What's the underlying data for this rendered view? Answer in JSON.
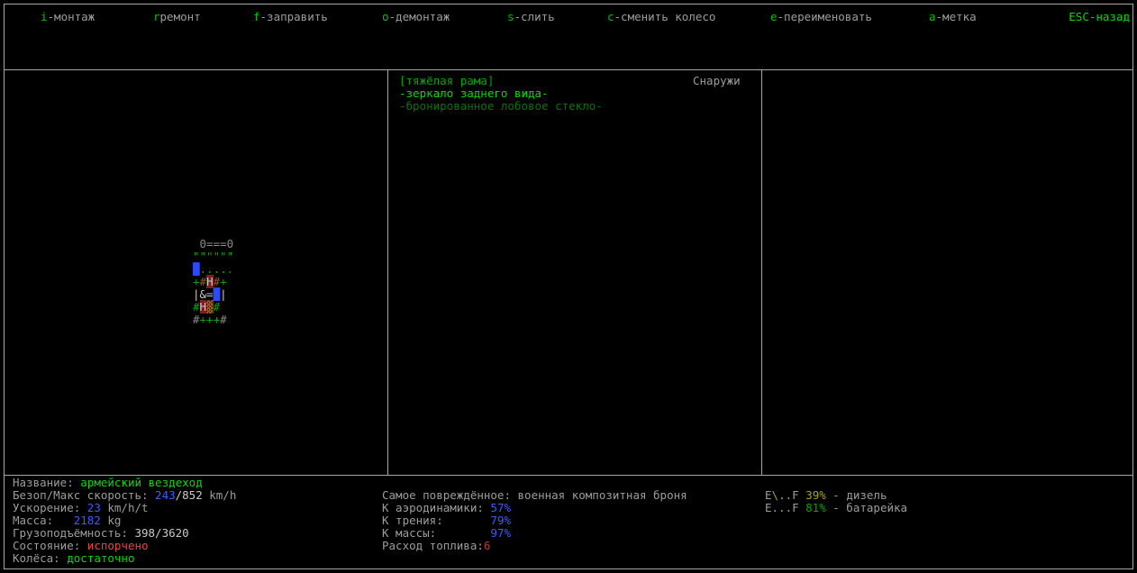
{
  "colors": {
    "label": "#9c9c9c",
    "white": "#c9c9c9",
    "gray": "#8a8a8a",
    "hotkey": "#00c000",
    "green_bright": "#00dc00",
    "green": "#00a800",
    "green_dark": "#0b700b",
    "blue": "#3c5cff",
    "blue_bright": "#2a4aff",
    "red": "#e04848",
    "red_dark": "#b23b2e",
    "yellow": "#a8a800",
    "brown": "#9c5a28",
    "seat_bg": "#7e1f1f"
  },
  "menu": {
    "items": [
      {
        "segs": [
          {
            "t": "i",
            "c": "hotkey"
          },
          {
            "t": "-монтаж",
            "c": "label"
          }
        ]
      },
      {
        "segs": [
          {
            "t": "r",
            "c": "hotkey"
          },
          {
            "t": "ремонт",
            "c": "label"
          }
        ]
      },
      {
        "segs": [
          {
            "t": "f",
            "c": "hotkey"
          },
          {
            "t": "-заправить",
            "c": "label"
          }
        ]
      },
      {
        "segs": [
          {
            "t": "o",
            "c": "hotkey"
          },
          {
            "t": "-демонтаж",
            "c": "label"
          }
        ]
      },
      {
        "segs": [
          {
            "t": "s",
            "c": "hotkey"
          },
          {
            "t": "-слить",
            "c": "label"
          }
        ]
      },
      {
        "segs": [
          {
            "t": "c",
            "c": "hotkey"
          },
          {
            "t": "-сменить колесо",
            "c": "label"
          }
        ]
      },
      {
        "segs": [
          {
            "t": "e",
            "c": "hotkey"
          },
          {
            "t": "-переименовать",
            "c": "label"
          }
        ]
      },
      {
        "segs": [
          {
            "t": "a",
            "c": "hotkey"
          },
          {
            "t": "-метка",
            "c": "label"
          }
        ]
      },
      {
        "segs": [
          {
            "t": "ESC",
            "c": "green_bright"
          },
          {
            "t": "-назад",
            "c": "green_bright"
          }
        ]
      }
    ]
  },
  "parts_panel": {
    "location_label": "Снаружи",
    "selected": {
      "segs": [
        {
          "t": "[",
          "c": "green"
        },
        {
          "t": "тяжёлая рама",
          "c": "green"
        },
        {
          "t": "]",
          "c": "green"
        }
      ]
    },
    "items": [
      {
        "segs": [
          {
            "t": "-зеркало заднего вида-",
            "c": "green_bright"
          }
        ]
      },
      {
        "segs": [
          {
            "t": "-бронированное лобовое стекло-",
            "c": "green_dark"
          }
        ]
      }
    ]
  },
  "vehicle_art": {
    "rows": [
      {
        "segs": [
          {
            "t": " 0===0",
            "c": "gray"
          }
        ]
      },
      {
        "segs": [
          {
            "t": "\"\"\"\"\"\"",
            "c": "green"
          }
        ]
      },
      {
        "segs": [
          {
            "t": "█",
            "c": "blue_bright"
          },
          {
            "t": ".....",
            "c": "green"
          }
        ]
      },
      {
        "segs": [
          {
            "t": "+",
            "c": "green"
          },
          {
            "t": "#",
            "c": "brown"
          },
          {
            "t": "H",
            "c": "white",
            "bg": "seat_bg"
          },
          {
            "t": "#",
            "c": "brown"
          },
          {
            "t": "+",
            "c": "green"
          }
        ]
      },
      {
        "segs": [
          {
            "t": "|&=",
            "c": "white"
          },
          {
            "t": "█",
            "c": "blue_bright"
          },
          {
            "t": "|",
            "c": "white"
          }
        ]
      },
      {
        "segs": [
          {
            "t": "#",
            "c": "green"
          },
          {
            "t": "H",
            "c": "white",
            "bg": "seat_bg"
          },
          {
            "t": "▓",
            "c": "brown"
          },
          {
            "t": "#",
            "c": "green"
          }
        ]
      },
      {
        "segs": [
          {
            "t": "#",
            "c": "gray"
          },
          {
            "t": "+++",
            "c": "green"
          },
          {
            "t": "#",
            "c": "gray"
          }
        ]
      }
    ]
  },
  "stats": {
    "lines": [
      {
        "segs": [
          {
            "t": "Название: ",
            "c": "label"
          },
          {
            "t": "армейский вездеход",
            "c": "green_bright"
          }
        ]
      },
      {
        "segs": [
          {
            "t": "Безоп/Макс скорость: ",
            "c": "label"
          },
          {
            "t": "243",
            "c": "blue"
          },
          {
            "t": "/852",
            "c": "white"
          },
          {
            "t": " km/h",
            "c": "label"
          }
        ]
      },
      {
        "segs": [
          {
            "t": "Ускорение: ",
            "c": "label"
          },
          {
            "t": "23",
            "c": "blue"
          },
          {
            "t": " km/h/t",
            "c": "label"
          }
        ]
      },
      {
        "segs": [
          {
            "t": "Масса:   ",
            "c": "label"
          },
          {
            "t": "2182",
            "c": "blue"
          },
          {
            "t": " kg",
            "c": "label"
          }
        ]
      },
      {
        "segs": [
          {
            "t": "Грузоподъёмность: ",
            "c": "label"
          },
          {
            "t": "398/3620",
            "c": "white"
          }
        ]
      },
      {
        "segs": [
          {
            "t": "Состояние: ",
            "c": "label"
          },
          {
            "t": "испорчено",
            "c": "red"
          }
        ]
      },
      {
        "segs": [
          {
            "t": "Колёса: ",
            "c": "label"
          },
          {
            "t": "достаточно",
            "c": "green_bright"
          }
        ]
      }
    ]
  },
  "coefficients": {
    "lines": [
      {
        "segs": [
          {
            "t": "Самое повреждённое: ",
            "c": "label"
          },
          {
            "t": "военная композитная броня",
            "c": "label"
          }
        ]
      },
      {
        "segs": [
          {
            "t": "К аэродинамики: ",
            "c": "label"
          },
          {
            "t": "57%",
            "c": "blue"
          }
        ]
      },
      {
        "segs": [
          {
            "t": "К трения:       ",
            "c": "label"
          },
          {
            "t": "79%",
            "c": "blue"
          }
        ]
      },
      {
        "segs": [
          {
            "t": "К массы:        ",
            "c": "label"
          },
          {
            "t": "97%",
            "c": "blue"
          }
        ]
      },
      {
        "segs": [
          {
            "t": "Расход топлива:",
            "c": "label"
          },
          {
            "t": "6",
            "c": "red_dark"
          }
        ]
      }
    ]
  },
  "fuel": {
    "lines": [
      {
        "segs": [
          {
            "t": "E",
            "c": "label"
          },
          {
            "t": "\\",
            "c": "yellow"
          },
          {
            "t": "..F ",
            "c": "label"
          },
          {
            "t": "39%",
            "c": "yellow"
          },
          {
            "t": " - дизель",
            "c": "label"
          }
        ]
      },
      {
        "segs": [
          {
            "t": "E...F ",
            "c": "label"
          },
          {
            "t": "81%",
            "c": "green"
          },
          {
            "t": " - батарейка",
            "c": "label"
          }
        ]
      }
    ]
  }
}
